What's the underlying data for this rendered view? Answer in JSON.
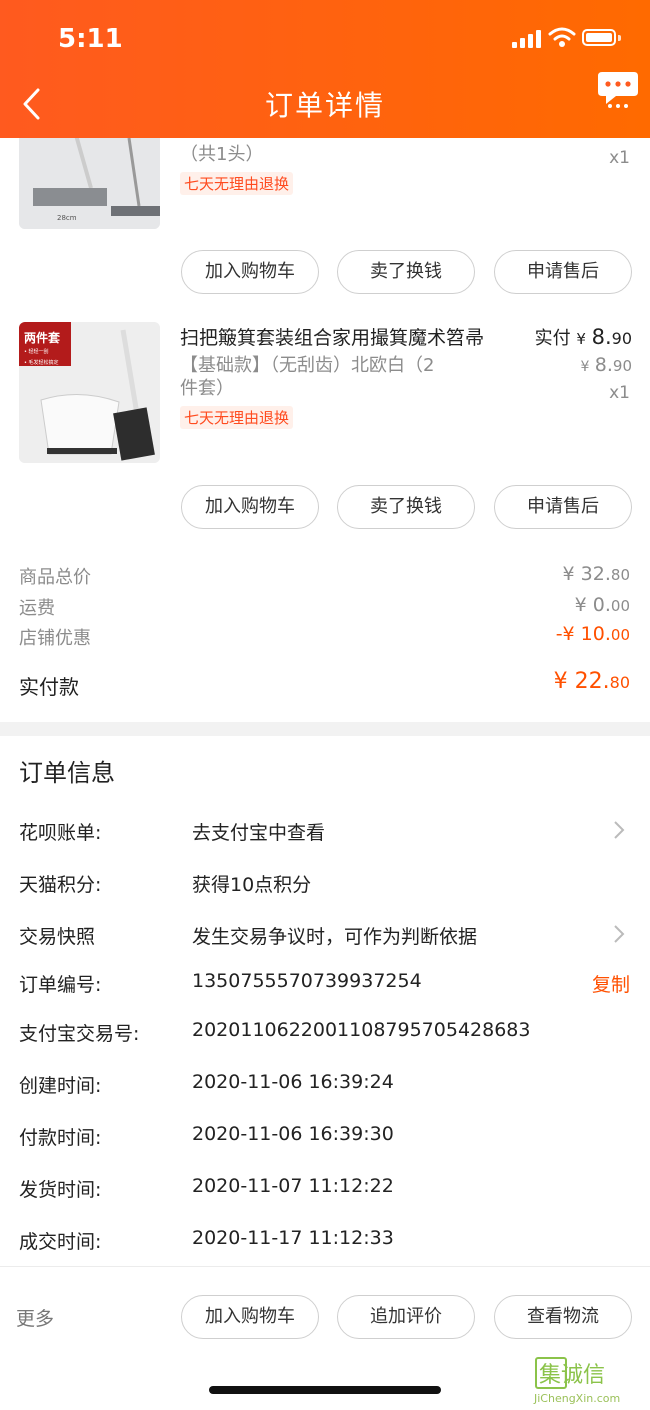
{
  "status_bar": {
    "time": "5:11"
  },
  "header": {
    "title": "订单详情"
  },
  "items": [
    {
      "spec": "（共1头）",
      "qty": "x1",
      "badge": "七天无理由退换",
      "thumb_caption": "28cm",
      "actions": [
        "加入购物车",
        "卖了换钱",
        "申请售后"
      ]
    },
    {
      "name": "扫把簸箕套装组合家用撮箕魔术笤帚",
      "paid_label": "实付",
      "currency": "¥",
      "price_int": "8.",
      "price_dec": "90",
      "orig_int": "8.",
      "orig_dec": "90",
      "spec_line1": "【基础款】（无刮齿）北欧白（2",
      "spec_line2": "件套）",
      "qty": "x1",
      "badge": "七天无理由退换",
      "thumb_tag": "两件套",
      "thumb_note1": "• 轻轻一刮",
      "thumb_note2": "• 毛发轻松搞定",
      "actions": [
        "加入购物车",
        "卖了换钱",
        "申请售后"
      ]
    }
  ],
  "summary": {
    "goods_total_label": "商品总价",
    "goods_total_int": "¥ 32.",
    "goods_total_dec": "80",
    "shipping_label": "运费",
    "shipping_int": "¥ 0.",
    "shipping_dec": "00",
    "discount_label": "店铺优惠",
    "discount_int": "-¥ 10.",
    "discount_dec": "00",
    "paid_label": "实付款",
    "paid_int": "¥ 22.",
    "paid_dec": "80"
  },
  "order_info": {
    "title": "订单信息",
    "rows": [
      {
        "label": "花呗账单:",
        "value": "去支付宝中查看"
      },
      {
        "label": "天猫积分:",
        "value": "获得10点积分"
      },
      {
        "label": "交易快照",
        "value": "发生交易争议时，可作为判断依据"
      },
      {
        "label": "订单编号:",
        "value": "1350755570739937254",
        "action": "复制"
      },
      {
        "label": "支付宝交易号:",
        "value": "2020110622001108795705428683"
      },
      {
        "label": "创建时间:",
        "value": "2020-11-06 16:39:24"
      },
      {
        "label": "付款时间:",
        "value": "2020-11-06 16:39:30"
      },
      {
        "label": "发货时间:",
        "value": "2020-11-07 11:12:22"
      },
      {
        "label": "成交时间:",
        "value": "2020-11-17 11:12:33"
      }
    ]
  },
  "bottom_bar": {
    "more": "更多",
    "actions": [
      "加入购物车",
      "追加评价",
      "查看物流"
    ]
  },
  "watermark": {
    "text": "JiChengXin.com",
    "glyphs": "集诚信"
  },
  "colors": {
    "accent": "#ff5a1f",
    "price_red": "#ff5000",
    "badge_bg": "#fff0ea"
  }
}
